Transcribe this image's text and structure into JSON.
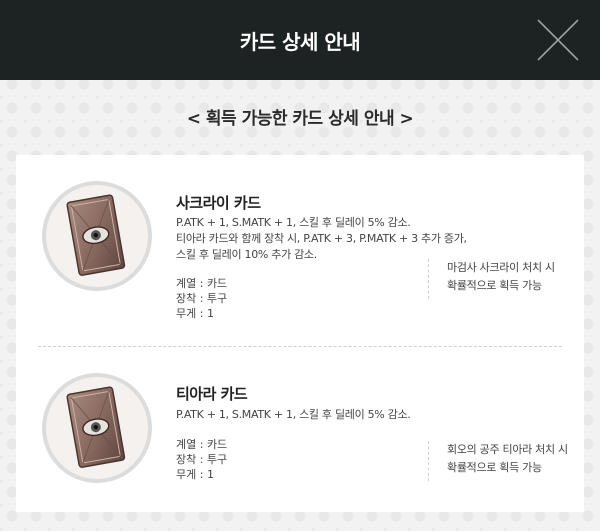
{
  "header": {
    "title": "카드 상세 안내"
  },
  "subtitle": "< 획득 가능한 카드 상세 안내 >",
  "cards": [
    {
      "name": "사크라이 카드",
      "effect_lines": [
        "P.ATK + 1, S.MATK + 1, 스킬 후 딜레이 5% 감소.",
        "티아라 카드와 함께 장착 시, P.ATK + 3, P.MATK + 3 추가 증가,",
        "스킬 후 딜레이 10% 추가 감소."
      ],
      "type": "계열 : 카드",
      "slot": "장착 : 투구",
      "weight": "무게 : 1",
      "acquire_lines": [
        "마검사 사크라이 처치 시",
        "확률적으로 획득 가능"
      ]
    },
    {
      "name": "티아라 카드",
      "effect_lines": [
        "P.ATK + 1, S.MATK + 1, 스킬 후 딜레이 5% 감소."
      ],
      "type": "계열 : 카드",
      "slot": "장착 : 투구",
      "weight": "무게 : 1",
      "acquire_lines": [
        "회오의 공주 티아라 처치 시",
        "확률적으로 획득 가능"
      ]
    }
  ],
  "colors": {
    "header_bg": "#1d2322",
    "page_bg": "#f2f2f2",
    "card_frame": "#8a6a5e"
  },
  "icons": {
    "close": "close-x-icon",
    "card": "card-eye-icon"
  }
}
